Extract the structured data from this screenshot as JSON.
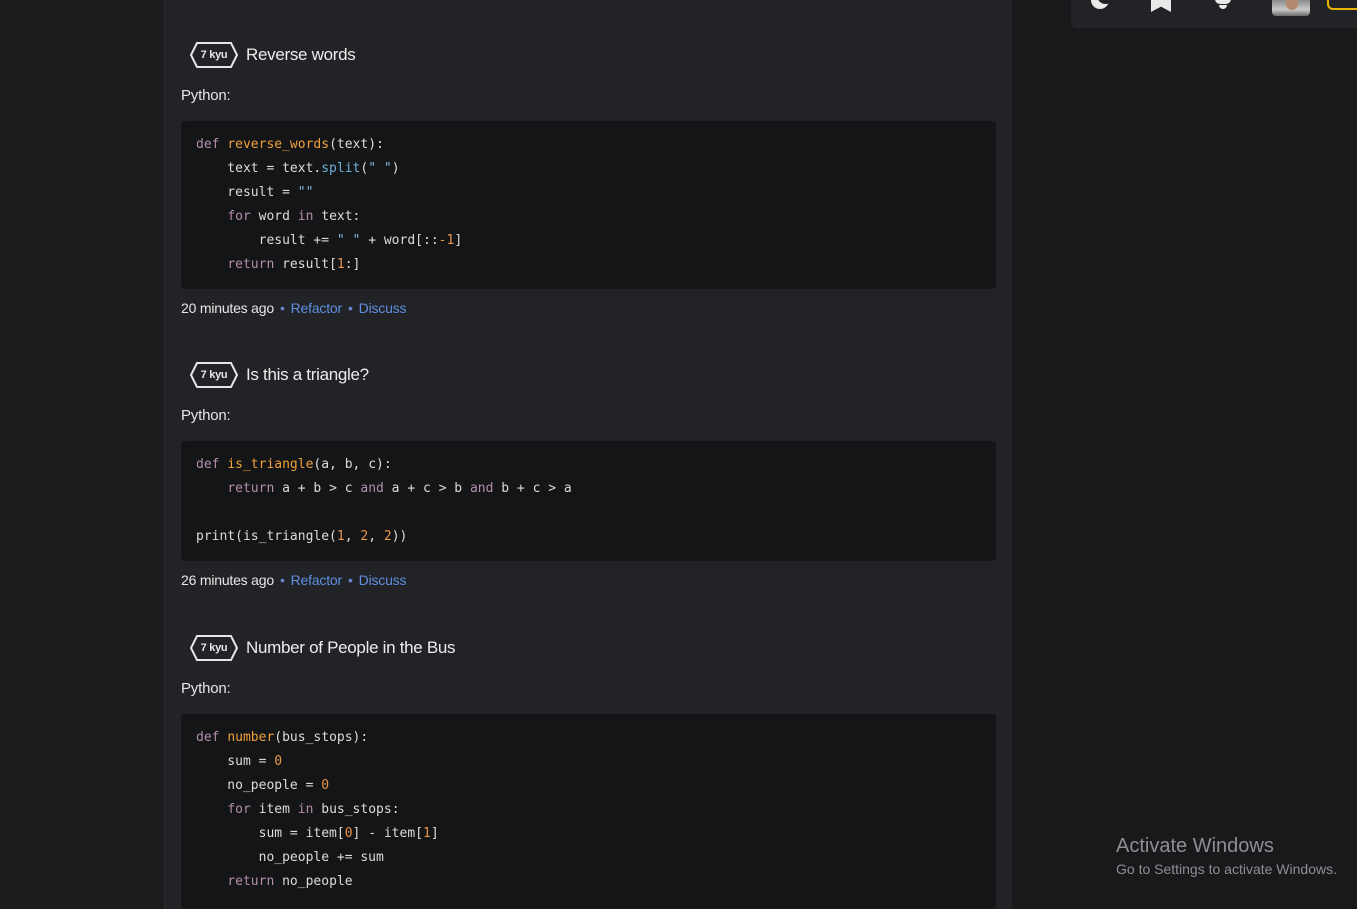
{
  "katas": [
    {
      "rank": "7 kyu",
      "title": "Reverse words",
      "language_label": "Python:",
      "time_ago": "20 minutes ago",
      "refactor_label": "Refactor",
      "discuss_label": "Discuss"
    },
    {
      "rank": "7 kyu",
      "title": "Is this a triangle?",
      "language_label": "Python:",
      "time_ago": "26 minutes ago",
      "refactor_label": "Refactor",
      "discuss_label": "Discuss"
    },
    {
      "rank": "7 kyu",
      "title": "Number of People in the Bus",
      "language_label": "Python:"
    }
  ],
  "header": {
    "icons": [
      "moon-icon",
      "bookmark-icon",
      "bell-icon"
    ],
    "rank_badge_color": "#e8b400"
  },
  "watermark": {
    "line1": "Activate Windows",
    "line2": "Go to Settings to activate Windows."
  },
  "colors": {
    "background": "#18191b",
    "panel": "#222326",
    "code_bg": "#141516",
    "link": "#5e8fe0",
    "keyword": "#b48ead",
    "function": "#f0a03c"
  }
}
